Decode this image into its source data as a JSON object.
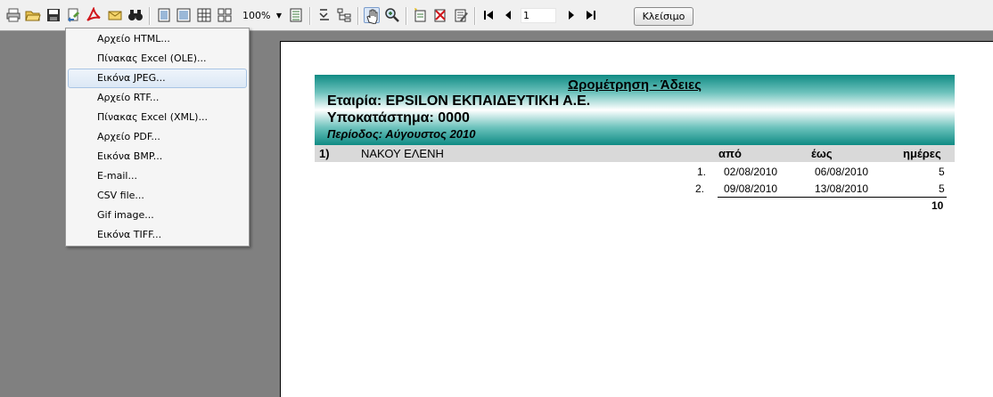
{
  "toolbar": {
    "zoom": "100%",
    "page_number": "1",
    "close_label": "Κλείσιμο"
  },
  "export_menu": {
    "items": [
      {
        "label": "Αρχείο HTML..."
      },
      {
        "label": "Πίνακας Excel (OLE)..."
      },
      {
        "label": "Εικόνα JPEG..."
      },
      {
        "label": "Αρχείο RTF..."
      },
      {
        "label": "Πίνακας Excel (XML)..."
      },
      {
        "label": "Αρχείο PDF..."
      },
      {
        "label": "Εικόνα BMP..."
      },
      {
        "label": "E-mail..."
      },
      {
        "label": "CSV file..."
      },
      {
        "label": "Gif image..."
      },
      {
        "label": "Εικόνα TIFF..."
      }
    ],
    "highlighted_index": 2
  },
  "report": {
    "title": "Ωρομέτρηση - Άδειες",
    "company": "Εταιρία: EPSILON ΕΚΠΑΙΔΕΥΤΙΚΗ Α.Ε.",
    "branch": "Υποκατάστημα: 0000",
    "period": "Περίοδος: Αύγουστος 2010",
    "group": {
      "number": "1)",
      "employee": "ΝΑΚΟΥ ΕΛΕΝΗ",
      "col_from": "από",
      "col_to": "έως",
      "col_days": "ημέρες"
    },
    "rows": [
      {
        "index": "1.",
        "from": "02/08/2010",
        "to": "06/08/2010",
        "days": "5"
      },
      {
        "index": "2.",
        "from": "09/08/2010",
        "to": "13/08/2010",
        "days": "5"
      }
    ],
    "total_days": "10"
  }
}
